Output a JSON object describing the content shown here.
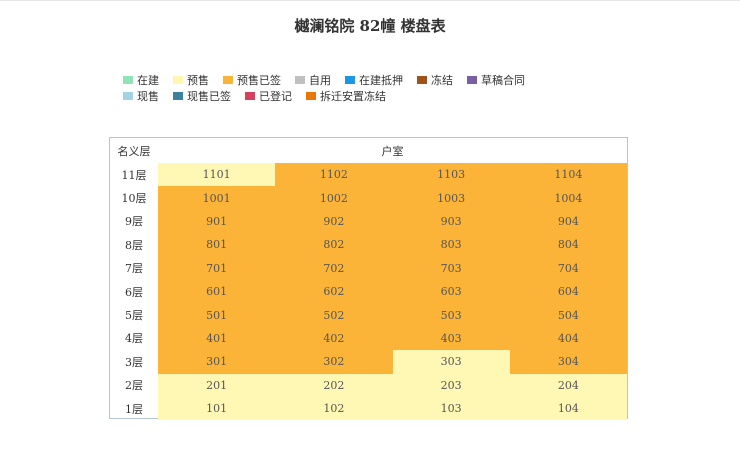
{
  "page": {
    "title": "樾澜铭院 82幢 楼盘表"
  },
  "legend": [
    [
      {
        "label": "在建",
        "color": "#8fe3b5"
      },
      {
        "label": "预售",
        "color": "#fff7b1"
      },
      {
        "label": "预售已签",
        "color": "#fbb438"
      },
      {
        "label": "自用",
        "color": "#c0c0c0"
      },
      {
        "label": "在建抵押",
        "color": "#1a98e6"
      },
      {
        "label": "冻结",
        "color": "#a0521c"
      },
      {
        "label": "草稿合同",
        "color": "#7b5fa4"
      }
    ],
    [
      {
        "label": "现售",
        "color": "#a3d3e3"
      },
      {
        "label": "现售已签",
        "color": "#3c82a0"
      },
      {
        "label": "已登记",
        "color": "#d94060"
      },
      {
        "label": "拆迁安置冻结",
        "color": "#e8780a"
      }
    ]
  ],
  "table": {
    "header_floor": "名义层",
    "header_unit": "户室",
    "rows": [
      {
        "floor": "11层",
        "units": [
          {
            "no": "1101",
            "status": "presale"
          },
          {
            "no": "1102",
            "status": "presale-signed"
          },
          {
            "no": "1103",
            "status": "presale-signed"
          },
          {
            "no": "1104",
            "status": "presale-signed"
          }
        ]
      },
      {
        "floor": "10层",
        "units": [
          {
            "no": "1001",
            "status": "presale-signed"
          },
          {
            "no": "1002",
            "status": "presale-signed"
          },
          {
            "no": "1003",
            "status": "presale-signed"
          },
          {
            "no": "1004",
            "status": "presale-signed"
          }
        ]
      },
      {
        "floor": "9层",
        "units": [
          {
            "no": "901",
            "status": "presale-signed"
          },
          {
            "no": "902",
            "status": "presale-signed"
          },
          {
            "no": "903",
            "status": "presale-signed"
          },
          {
            "no": "904",
            "status": "presale-signed"
          }
        ]
      },
      {
        "floor": "8层",
        "units": [
          {
            "no": "801",
            "status": "presale-signed"
          },
          {
            "no": "802",
            "status": "presale-signed"
          },
          {
            "no": "803",
            "status": "presale-signed"
          },
          {
            "no": "804",
            "status": "presale-signed"
          }
        ]
      },
      {
        "floor": "7层",
        "units": [
          {
            "no": "701",
            "status": "presale-signed"
          },
          {
            "no": "702",
            "status": "presale-signed"
          },
          {
            "no": "703",
            "status": "presale-signed"
          },
          {
            "no": "704",
            "status": "presale-signed"
          }
        ]
      },
      {
        "floor": "6层",
        "units": [
          {
            "no": "601",
            "status": "presale-signed"
          },
          {
            "no": "602",
            "status": "presale-signed"
          },
          {
            "no": "603",
            "status": "presale-signed"
          },
          {
            "no": "604",
            "status": "presale-signed"
          }
        ]
      },
      {
        "floor": "5层",
        "units": [
          {
            "no": "501",
            "status": "presale-signed"
          },
          {
            "no": "502",
            "status": "presale-signed"
          },
          {
            "no": "503",
            "status": "presale-signed"
          },
          {
            "no": "504",
            "status": "presale-signed"
          }
        ]
      },
      {
        "floor": "4层",
        "units": [
          {
            "no": "401",
            "status": "presale-signed"
          },
          {
            "no": "402",
            "status": "presale-signed"
          },
          {
            "no": "403",
            "status": "presale-signed"
          },
          {
            "no": "404",
            "status": "presale-signed"
          }
        ]
      },
      {
        "floor": "3层",
        "units": [
          {
            "no": "301",
            "status": "presale-signed"
          },
          {
            "no": "302",
            "status": "presale-signed"
          },
          {
            "no": "303",
            "status": "presale"
          },
          {
            "no": "304",
            "status": "presale-signed"
          }
        ]
      },
      {
        "floor": "2层",
        "units": [
          {
            "no": "201",
            "status": "presale"
          },
          {
            "no": "202",
            "status": "presale"
          },
          {
            "no": "203",
            "status": "presale"
          },
          {
            "no": "204",
            "status": "presale"
          }
        ]
      },
      {
        "floor": "1层",
        "units": [
          {
            "no": "101",
            "status": "presale"
          },
          {
            "no": "102",
            "status": "presale"
          },
          {
            "no": "103",
            "status": "presale"
          },
          {
            "no": "104",
            "status": "presale"
          }
        ]
      }
    ]
  }
}
